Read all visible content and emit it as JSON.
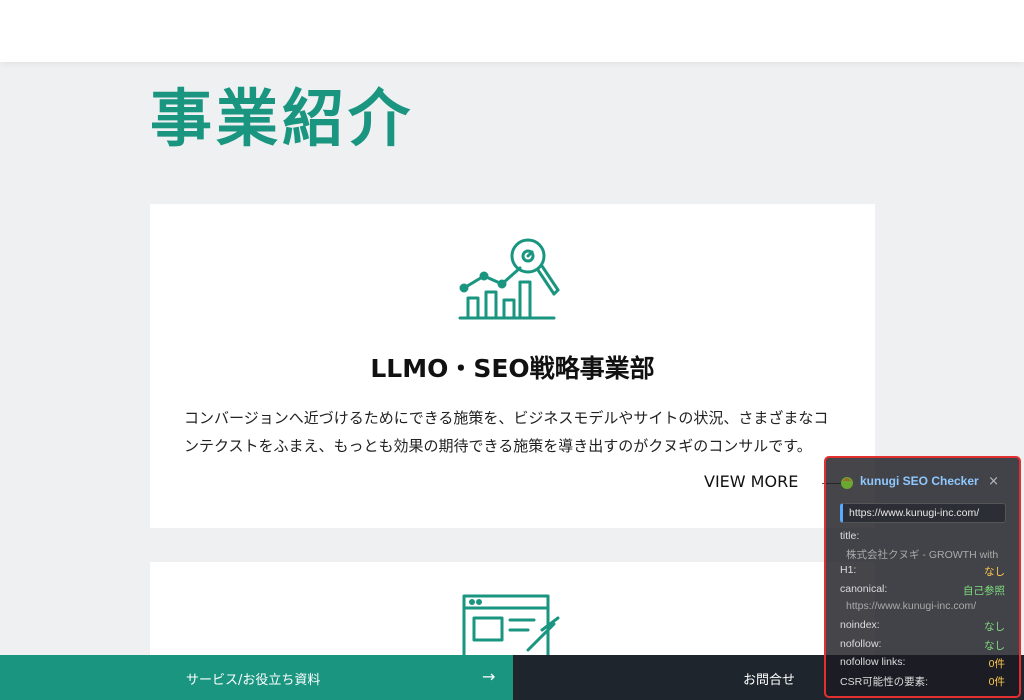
{
  "page": {
    "title": "事業紹介"
  },
  "cards": [
    {
      "icon": "seo-analytics-icon",
      "title": "LLMO・SEO戦略事業部",
      "description_line1": "コンバージョンへ近づけるためにできる施策を、ビジネスモデルやサイトの状況、さまざまなコ",
      "description_line2": "ンテクストをふまえ、もっとも効果の期待できる施策を導き出すのがクヌギのコンサルです。",
      "link_label": "VIEW MORE"
    },
    {
      "icon": "content-writing-icon"
    }
  ],
  "bottom_bar": {
    "left_label": "サービス/お役立ち資料",
    "left_arrow": "→",
    "right_label": "お問合せ"
  },
  "seo_checker": {
    "title": "kunugi SEO Checker",
    "close": "×",
    "url": "https://www.kunugi-inc.com/",
    "rows": {
      "title_label": "title:",
      "title_value": "株式会社クヌギ - GROWTH with",
      "h1_label": "H1:",
      "h1_value": "なし",
      "canonical_label": "canonical:",
      "canonical_value": "自己参照",
      "canonical_url": "https://www.kunugi-inc.com/",
      "noindex_label": "noindex:",
      "noindex_value": "なし",
      "nofollow_label": "nofollow:",
      "nofollow_value": "なし",
      "nofollow_links_label": "nofollow links:",
      "nofollow_links_value": "0件",
      "csr_label": "CSR可能性の要素:",
      "csr_value": "0件"
    },
    "colors": {
      "warning": "#ffc94d",
      "ok": "#7fdc7f",
      "border": "#e23030"
    }
  },
  "colors": {
    "brand": "#1a9580",
    "dark": "#1f252d"
  }
}
